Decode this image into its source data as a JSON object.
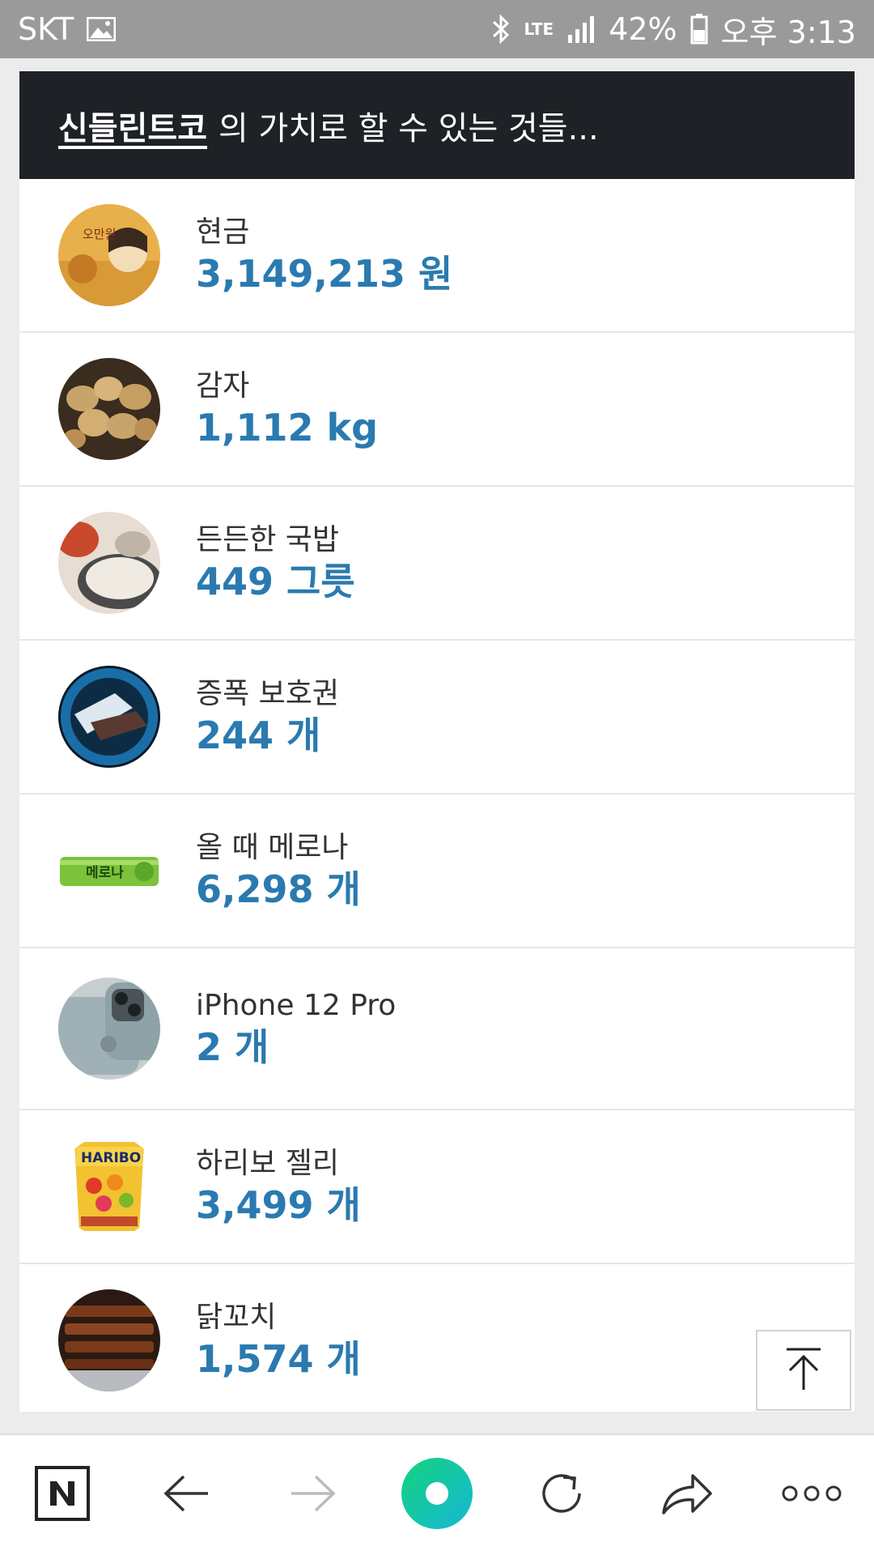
{
  "status_bar": {
    "carrier": "SKT",
    "network": "LTE",
    "battery": "42%",
    "time": "오후 3:13"
  },
  "header": {
    "coin_name": "신들린트코",
    "suffix": "의 가치로 할 수 있는 것들..."
  },
  "items": [
    {
      "label": "현금",
      "value": "3,149,213 원",
      "icon": "cash-bill-icon"
    },
    {
      "label": "감자",
      "value": "1,112 kg",
      "icon": "potato-icon"
    },
    {
      "label": "든든한 국밥",
      "value": "449 그릇",
      "icon": "gukbap-icon"
    },
    {
      "label": "증폭 보호권",
      "value": "244 개",
      "icon": "protection-scroll-icon"
    },
    {
      "label": "올 때 메로나",
      "value": "6,298 개",
      "icon": "melona-icon"
    },
    {
      "label": "iPhone 12 Pro",
      "value": "2 개",
      "icon": "iphone-icon"
    },
    {
      "label": "하리보 젤리",
      "value": "3,499 개",
      "icon": "haribo-icon"
    },
    {
      "label": "닭꼬치",
      "value": "1,574 개",
      "icon": "chicken-skewer-icon"
    }
  ],
  "thumb_text": {
    "bill": "오만원",
    "melona": "메로나",
    "haribo": "HARIBO"
  },
  "colors": {
    "value_blue": "#2a7ab0",
    "header_bg": "#1e2125",
    "naver_green": "#03c75a"
  }
}
